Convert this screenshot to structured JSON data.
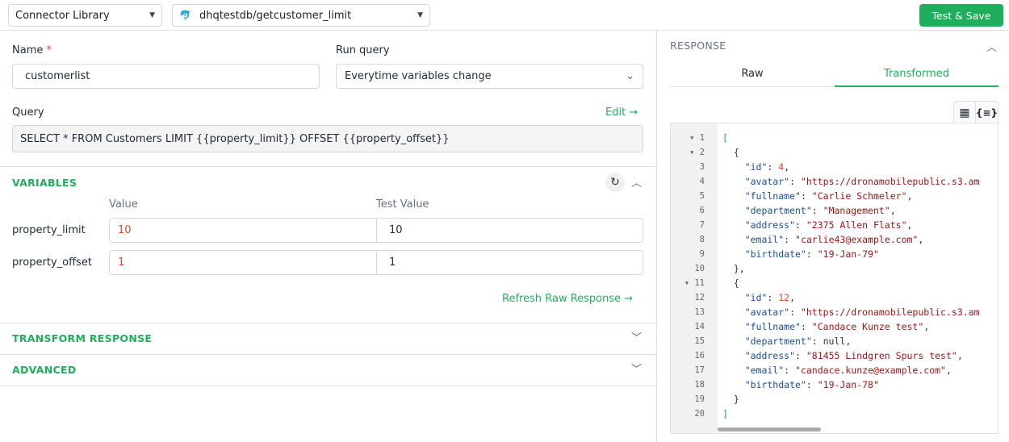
{
  "topbar": {
    "connector_select": "Connector Library",
    "query_select": "dhqtestdb/getcustomer_limit",
    "test_save": "Test & Save"
  },
  "form": {
    "name_label": "Name",
    "required_mark": "*",
    "name_value": "customerlist",
    "run_label": "Run query",
    "run_value": "Everytime variables change",
    "query_label": "Query",
    "edit_label": "Edit",
    "query_value": "SELECT * FROM Customers LIMIT {{property_limit}} OFFSET {{property_offset}}"
  },
  "variables": {
    "title": "VARIABLES",
    "col_value": "Value",
    "col_test": "Test Value",
    "rows": [
      {
        "name": "property_limit",
        "value": "10",
        "test": "10"
      },
      {
        "name": "property_offset",
        "value": "1",
        "test": "1"
      }
    ],
    "refresh": "Refresh Raw Response"
  },
  "sections": {
    "transform": "TRANSFORM RESPONSE",
    "advanced": "ADVANCED"
  },
  "response": {
    "title": "RESPONSE",
    "tabs": [
      {
        "label": "Raw",
        "active": false
      },
      {
        "label": "Transformed",
        "active": true
      }
    ],
    "lines": [
      {
        "n": "1",
        "fold": true,
        "t": [
          [
            "b",
            "["
          ]
        ]
      },
      {
        "n": "2",
        "fold": true,
        "t": [
          [
            "p",
            "  {"
          ]
        ]
      },
      {
        "n": "3",
        "t": [
          [
            "k",
            "    \"id\""
          ],
          [
            "p",
            ": "
          ],
          [
            "n",
            "4"
          ],
          [
            "p",
            ","
          ]
        ]
      },
      {
        "n": "4",
        "t": [
          [
            "k",
            "    \"avatar\""
          ],
          [
            "p",
            ": "
          ],
          [
            "s",
            "\"https://dronamobilepublic.s3.am"
          ]
        ]
      },
      {
        "n": "5",
        "t": [
          [
            "k",
            "    \"fullname\""
          ],
          [
            "p",
            ": "
          ],
          [
            "s",
            "\"Carlie Schmeler\""
          ],
          [
            "p",
            ","
          ]
        ]
      },
      {
        "n": "6",
        "t": [
          [
            "k",
            "    \"department\""
          ],
          [
            "p",
            ": "
          ],
          [
            "s",
            "\"Management\""
          ],
          [
            "p",
            ","
          ]
        ]
      },
      {
        "n": "7",
        "t": [
          [
            "k",
            "    \"address\""
          ],
          [
            "p",
            ": "
          ],
          [
            "s",
            "\"2375 Allen Flats\""
          ],
          [
            "p",
            ","
          ]
        ]
      },
      {
        "n": "8",
        "t": [
          [
            "k",
            "    \"email\""
          ],
          [
            "p",
            ": "
          ],
          [
            "s",
            "\"carlie43@example.com\""
          ],
          [
            "p",
            ","
          ]
        ]
      },
      {
        "n": "9",
        "t": [
          [
            "k",
            "    \"birthdate\""
          ],
          [
            "p",
            ": "
          ],
          [
            "s",
            "\"19-Jan-79\""
          ]
        ]
      },
      {
        "n": "10",
        "t": [
          [
            "p",
            "  },"
          ]
        ]
      },
      {
        "n": "11",
        "fold": true,
        "t": [
          [
            "p",
            "  {"
          ]
        ]
      },
      {
        "n": "12",
        "t": [
          [
            "k",
            "    \"id\""
          ],
          [
            "p",
            ": "
          ],
          [
            "n",
            "12"
          ],
          [
            "p",
            ","
          ]
        ]
      },
      {
        "n": "13",
        "t": [
          [
            "k",
            "    \"avatar\""
          ],
          [
            "p",
            ": "
          ],
          [
            "s",
            "\"https://dronamobilepublic.s3.am"
          ]
        ]
      },
      {
        "n": "14",
        "t": [
          [
            "k",
            "    \"fullname\""
          ],
          [
            "p",
            ": "
          ],
          [
            "s",
            "\"Candace Kunze test\""
          ],
          [
            "p",
            ","
          ]
        ]
      },
      {
        "n": "15",
        "t": [
          [
            "k",
            "    \"department\""
          ],
          [
            "p",
            ": null,"
          ]
        ]
      },
      {
        "n": "16",
        "t": [
          [
            "k",
            "    \"address\""
          ],
          [
            "p",
            ": "
          ],
          [
            "s",
            "\"81455 Lindgren Spurs test\""
          ],
          [
            "p",
            ","
          ]
        ]
      },
      {
        "n": "17",
        "t": [
          [
            "k",
            "    \"email\""
          ],
          [
            "p",
            ": "
          ],
          [
            "s",
            "\"candace.kunze@example.com\""
          ],
          [
            "p",
            ","
          ]
        ]
      },
      {
        "n": "18",
        "t": [
          [
            "k",
            "    \"birthdate\""
          ],
          [
            "p",
            ": "
          ],
          [
            "s",
            "\"19-Jan-78\""
          ]
        ]
      },
      {
        "n": "19",
        "t": [
          [
            "p",
            "  }"
          ]
        ]
      },
      {
        "n": "20",
        "t": [
          [
            "b",
            "]"
          ]
        ]
      }
    ]
  },
  "colors": {
    "accent": "#1fae5b"
  }
}
